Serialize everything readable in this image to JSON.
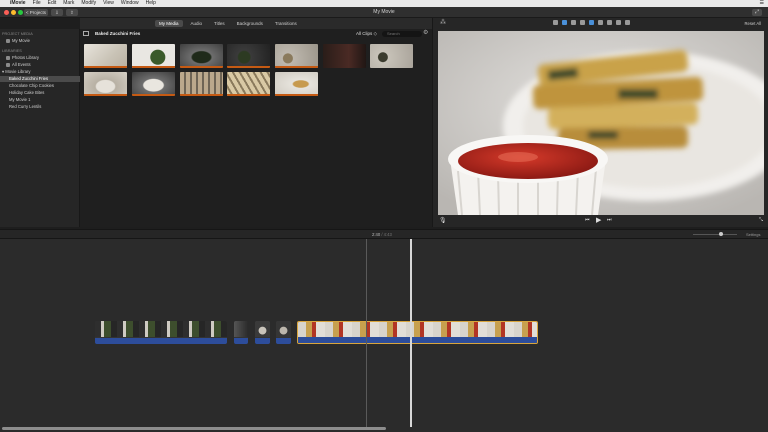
{
  "menubar": {
    "app": "iMovie",
    "items": [
      "File",
      "Edit",
      "Mark",
      "Modify",
      "View",
      "Window",
      "Help"
    ]
  },
  "titlebar": {
    "title": "My Movie",
    "projects_label": "< Projects"
  },
  "tabs": [
    {
      "label": "My Media",
      "active": true
    },
    {
      "label": "Audio",
      "active": false
    },
    {
      "label": "Titles",
      "active": false
    },
    {
      "label": "Backgrounds",
      "active": false
    },
    {
      "label": "Transitions",
      "active": false
    }
  ],
  "sidebar": {
    "project_media_header": "PROJECT MEDIA",
    "my_movie": "My Movie",
    "libraries_header": "LIBRARIES",
    "photos_library": "Photos Library",
    "all_events": "All Events",
    "movie_library": "Movie Library",
    "events": [
      {
        "label": "Baked Zucchini Fries",
        "selected": true
      },
      {
        "label": "Chocolate Chip Cookies",
        "selected": false
      },
      {
        "label": "Holiday Cake Bites",
        "selected": false
      },
      {
        "label": "My Movie 1",
        "selected": false
      },
      {
        "label": "Red Curry Lentils",
        "selected": false
      }
    ]
  },
  "browser": {
    "event_title": "Baked Zucchini Fries",
    "clip_filter": "All Clips ◇",
    "search_placeholder": "Search"
  },
  "viewer": {
    "reset_all": "Reset All"
  },
  "timeline": {
    "timecode_current": "2:40",
    "timecode_separator": " / ",
    "timecode_total": "4:43",
    "settings_label": "Settings"
  },
  "colors": {
    "accent_blue": "#4a90d9",
    "audio_track": "#2d4d9b",
    "selection": "#d9a53c",
    "used_clip_strip": "#c55a13"
  }
}
